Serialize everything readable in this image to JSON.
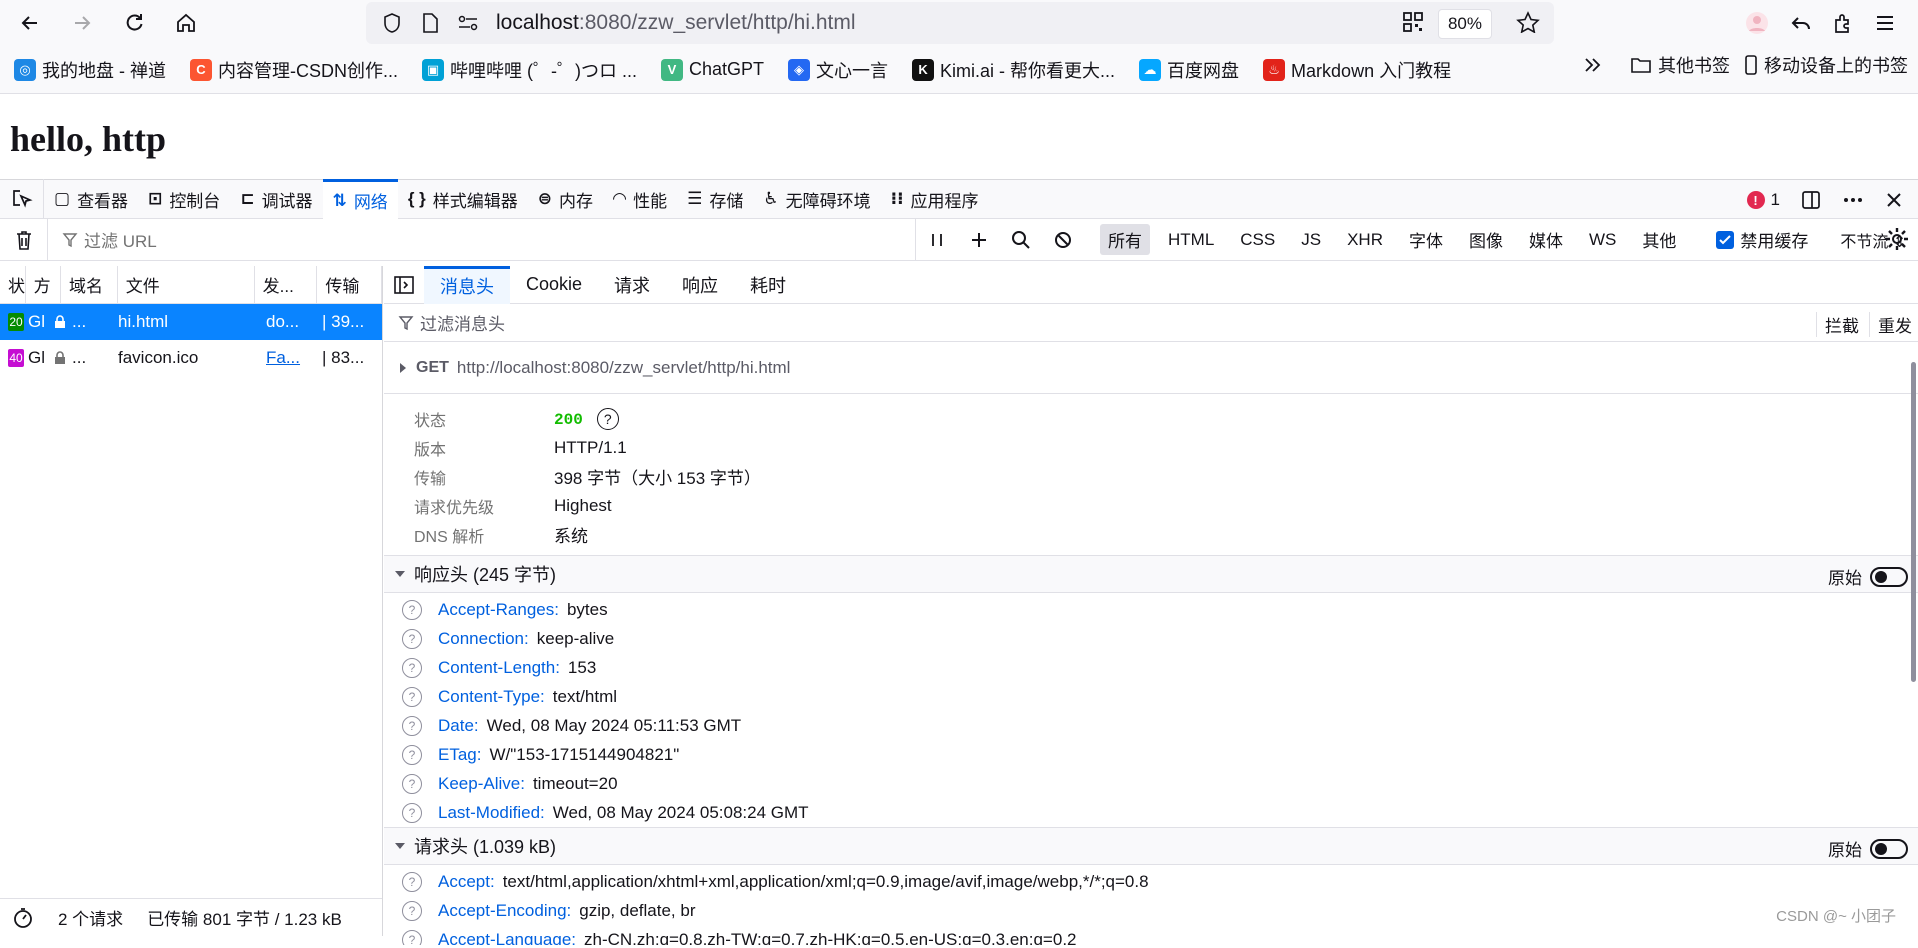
{
  "browser": {
    "url_host": "localhost",
    "url_rest": ":8080/zzw_servlet/http/hi.html",
    "zoom": "80%"
  },
  "bookmarks": [
    {
      "label": "我的地盘 - 禅道",
      "color": "#1e88e5",
      "glyph": "◎"
    },
    {
      "label": "内容管理-CSDN创作...",
      "color": "#fc5531",
      "glyph": "C"
    },
    {
      "label": "哔哩哔哩 (゜-゜)つロ ...",
      "color": "#00a1d6",
      "glyph": "▣"
    },
    {
      "label": "ChatGPT",
      "color": "#41b883",
      "glyph": "V"
    },
    {
      "label": "文心一言",
      "color": "#2468f2",
      "glyph": "◈"
    },
    {
      "label": "Kimi.ai - 帮你看更大...",
      "color": "#111111",
      "glyph": "K"
    },
    {
      "label": "百度网盘",
      "color": "#06a7ff",
      "glyph": "☁"
    },
    {
      "label": "Markdown 入门教程",
      "color": "#e2231a",
      "glyph": "♨"
    }
  ],
  "bookmarks_right": {
    "other": "其他书签",
    "mobile": "移动设备上的书签"
  },
  "page": {
    "heading": "hello, http"
  },
  "devtools": {
    "tabs": [
      "查看器",
      "控制台",
      "调试器",
      "网络",
      "样式编辑器",
      "内存",
      "性能",
      "存储",
      "无障碍环境",
      "应用程序"
    ],
    "active_tab": "网络",
    "error_count": "1"
  },
  "network": {
    "filter_placeholder": "过滤 URL",
    "types": [
      "所有",
      "HTML",
      "CSS",
      "JS",
      "XHR",
      "字体",
      "图像",
      "媒体",
      "WS",
      "其他"
    ],
    "disable_cache": "禁用缓存",
    "throttle": "不节流 ⇕",
    "columns": [
      "状",
      "方",
      "域名",
      "文件",
      "发...",
      "传输"
    ],
    "requests": [
      {
        "status": "20",
        "status_color": "#058b00",
        "method": "Gl",
        "domain": "...",
        "file": "hi.html",
        "initiator": "do...",
        "transfer": "| 39...",
        "selected": true
      },
      {
        "status": "40",
        "status_color": "#c50ed2",
        "method": "Gl",
        "domain": "...",
        "file": "favicon.ico",
        "initiator": "Fa...",
        "transfer": "| 83...",
        "selected": false
      }
    ],
    "footer": {
      "count": "2 个请求",
      "transferred": "已传输 801 字节 / 1.23 kB"
    }
  },
  "detail": {
    "tabs": [
      "消息头",
      "Cookie",
      "请求",
      "响应",
      "耗时"
    ],
    "filter_placeholder": "过滤消息头",
    "block": "拦截",
    "resend": "重发",
    "method": "GET",
    "url": "http://localhost:8080/zzw_servlet/http/hi.html",
    "summary": [
      {
        "k": "状态",
        "v": "200"
      },
      {
        "k": "版本",
        "v": "HTTP/1.1"
      },
      {
        "k": "传输",
        "v": "398 字节（大小 153 字节）"
      },
      {
        "k": "请求优先级",
        "v": "Highest"
      },
      {
        "k": "DNS 解析",
        "v": "系统"
      }
    ],
    "response_title": "响应头 (245 字节)",
    "raw_label": "原始",
    "response_headers": [
      {
        "k": "Accept-Ranges:",
        "v": "bytes"
      },
      {
        "k": "Connection:",
        "v": "keep-alive"
      },
      {
        "k": "Content-Length:",
        "v": "153"
      },
      {
        "k": "Content-Type:",
        "v": "text/html"
      },
      {
        "k": "Date:",
        "v": "Wed, 08 May 2024 05:11:53 GMT"
      },
      {
        "k": "ETag:",
        "v": "W/\"153-1715144904821\""
      },
      {
        "k": "Keep-Alive:",
        "v": "timeout=20"
      },
      {
        "k": "Last-Modified:",
        "v": "Wed, 08 May 2024 05:08:24 GMT"
      }
    ],
    "request_title": "请求头 (1.039 kB)",
    "request_headers": [
      {
        "k": "Accept:",
        "v": "text/html,application/xhtml+xml,application/xml;q=0.9,image/avif,image/webp,*/*;q=0.8"
      },
      {
        "k": "Accept-Encoding:",
        "v": "gzip, deflate, br"
      },
      {
        "k": "Accept-Language:",
        "v": "zh-CN,zh;q=0.8,zh-TW;q=0.7,zh-HK;q=0.5,en-US;q=0.3,en;q=0.2"
      }
    ]
  },
  "watermark": "CSDN @~ 小团子"
}
